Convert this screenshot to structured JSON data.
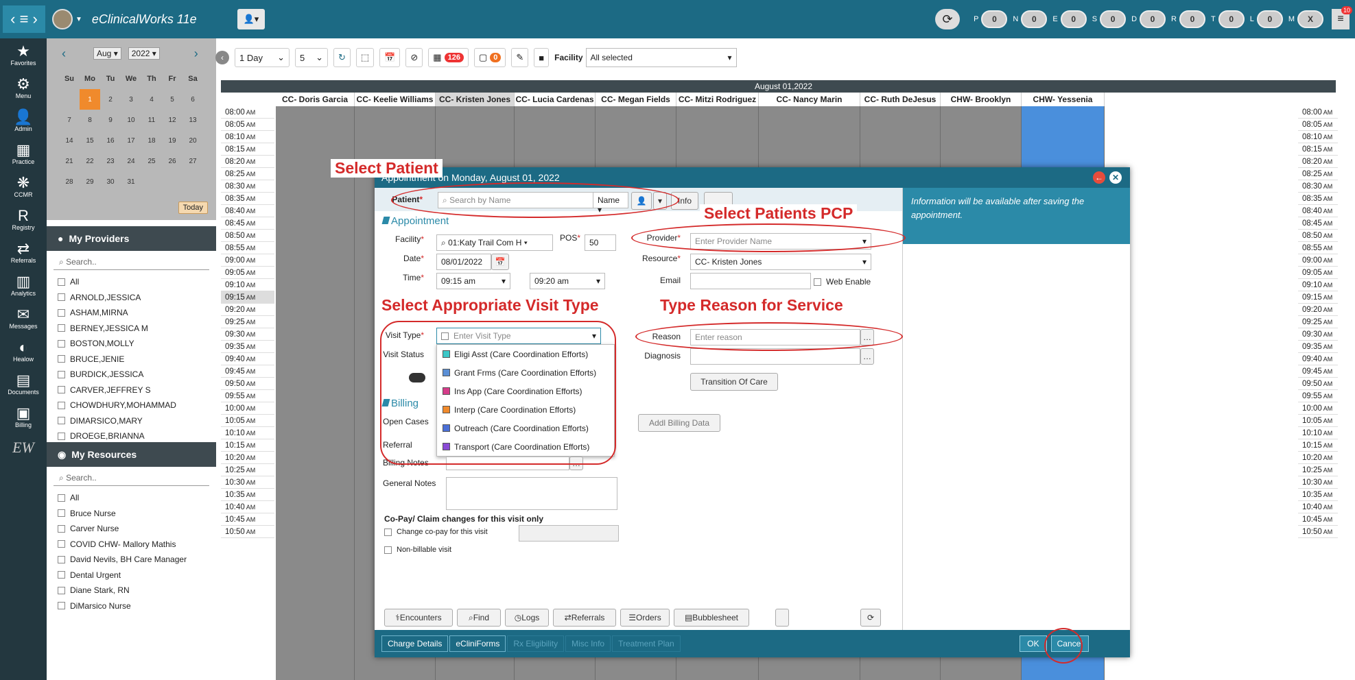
{
  "app": {
    "title": "eClinicalWorks 11e"
  },
  "topbar": {
    "counters": [
      {
        "key": "P",
        "value": "0"
      },
      {
        "key": "N",
        "value": "0"
      },
      {
        "key": "E",
        "value": "0"
      },
      {
        "key": "S",
        "value": "0"
      },
      {
        "key": "D",
        "value": "0"
      },
      {
        "key": "R",
        "value": "0"
      },
      {
        "key": "T",
        "value": "0"
      },
      {
        "key": "L",
        "value": "0"
      },
      {
        "key": "M",
        "value": "X"
      }
    ],
    "notif_count": "10"
  },
  "leftnav": {
    "items": [
      {
        "label": "Favorites",
        "icon": "★"
      },
      {
        "label": "Menu",
        "icon": "⚙"
      },
      {
        "label": "Admin",
        "icon": "👤"
      },
      {
        "label": "Practice",
        "icon": "▦"
      },
      {
        "label": "CCMR",
        "icon": "❋"
      },
      {
        "label": "Registry",
        "icon": "R"
      },
      {
        "label": "Referrals",
        "icon": "⇄"
      },
      {
        "label": "Analytics",
        "icon": "▥"
      },
      {
        "label": "Messages",
        "icon": "✉"
      },
      {
        "label": "Healow",
        "icon": "◐"
      },
      {
        "label": "Documents",
        "icon": "▤"
      },
      {
        "label": "Billing",
        "icon": "▣"
      }
    ],
    "logo": "EW"
  },
  "calendar": {
    "month": "Aug",
    "year": "2022",
    "days": [
      "Su",
      "Mo",
      "Tu",
      "We",
      "Th",
      "Fr",
      "Sa"
    ],
    "weeks": [
      [
        "",
        "1",
        "2",
        "3",
        "4",
        "5",
        "6"
      ],
      [
        "7",
        "8",
        "9",
        "10",
        "11",
        "12",
        "13"
      ],
      [
        "14",
        "15",
        "16",
        "17",
        "18",
        "19",
        "20"
      ],
      [
        "21",
        "22",
        "23",
        "24",
        "25",
        "26",
        "27"
      ],
      [
        "28",
        "29",
        "30",
        "31",
        "",
        "",
        ""
      ]
    ],
    "today_label": "Today"
  },
  "providers": {
    "title": "My Providers",
    "search_placeholder": "Search..",
    "items": [
      "All",
      "ARNOLD,JESSICA",
      "ASHAM,MIRNA",
      "BERNEY,JESSICA M",
      "BOSTON,MOLLY",
      "BRUCE,JENIE",
      "BURDICK,JESSICA",
      "CARVER,JEFFREY S",
      "CHOWDHURY,MOHAMMAD",
      "DIMARSICO,MARY",
      "DROEGE,BRIANNA"
    ]
  },
  "resources": {
    "title": "My Resources",
    "search_placeholder": "Search..",
    "items": [
      "All",
      "Bruce Nurse",
      "Carver Nurse",
      "COVID CHW- Mallory Mathis",
      "David Nevils, BH Care Manager",
      "Dental Urgent",
      "Diane Stark, RN",
      "DiMarsico Nurse"
    ]
  },
  "toolbar": {
    "view": "1 Day",
    "interval": "5",
    "badge1": "126",
    "badge2": "0",
    "facility_label": "Facility",
    "facility_value": "All selected"
  },
  "schedule": {
    "date": "August 01,2022",
    "columns": [
      "CC- Doris Garcia",
      "CC- Keelie Williams",
      "CC- Kristen Jones",
      "CC- Lucia Cardenas",
      "CC- Megan Fields",
      "CC- Mitzi Rodriguez",
      "CC- Nancy Marin",
      "CC- Ruth DeJesus",
      "CHW- Brooklyn James",
      "CHW- Yessenia Lopez"
    ],
    "times": [
      "08:00",
      "08:05",
      "08:10",
      "08:15",
      "08:20",
      "08:25",
      "08:30",
      "08:35",
      "08:40",
      "08:45",
      "08:50",
      "08:55",
      "09:00",
      "09:05",
      "09:10",
      "09:15",
      "09:20",
      "09:25",
      "09:30",
      "09:35",
      "09:40",
      "09:45",
      "09:50",
      "09:55",
      "10:00",
      "10:05",
      "10:10",
      "10:15",
      "10:20",
      "10:25",
      "10:30",
      "10:35",
      "10:40",
      "10:45",
      "10:50"
    ],
    "ampm": "AM"
  },
  "modal": {
    "title": "Appointment on Monday, August 01, 2022",
    "patient_label": "Patient",
    "patient_placeholder": "Search by Name",
    "name_dd": "Name",
    "info_btn": "Info",
    "section_appointment": "Appointment",
    "facility_label": "Facility",
    "facility_value": "01:Katy Trail Com H",
    "pos_label": "POS",
    "pos_value": "50",
    "date_label": "Date",
    "date_value": "08/01/2022",
    "time_label": "Time",
    "time_start": "09:15 am",
    "time_end": "09:20 am",
    "provider_label": "Provider",
    "provider_placeholder": "Enter Provider Name",
    "resource_label": "Resource",
    "resource_value": "CC- Kristen Jones",
    "email_label": "Email",
    "web_enable": "Web Enable",
    "visit_type_label": "Visit Type",
    "visit_type_placeholder": "Enter Visit Type",
    "visit_status_label": "Visit Status",
    "visit_types": [
      {
        "label": "Eligi Asst (Care Coordination Efforts)",
        "color": "#3cc7c7"
      },
      {
        "label": "Grant Frms (Care Coordination Efforts)",
        "color": "#5b8fd6"
      },
      {
        "label": "Ins App (Care Coordination Efforts)",
        "color": "#d63c8a"
      },
      {
        "label": "Interp (Care Coordination Efforts)",
        "color": "#f08a2c"
      },
      {
        "label": "Outreach (Care Coordination Efforts)",
        "color": "#4b6fd6"
      },
      {
        "label": "Transport (Care Coordination Efforts)",
        "color": "#8a4bd6"
      }
    ],
    "reason_label": "Reason",
    "reason_placeholder": "Enter reason",
    "diagnosis_label": "Diagnosis",
    "transition_btn": "Transition Of Care",
    "section_billing": "Billing",
    "open_cases": "Open Cases",
    "referral": "Referral",
    "billing_notes": "Billing Notes",
    "general_notes": "General Notes",
    "addl_billing": "Addl Billing Data",
    "copay_heading": "Co-Pay/ Claim changes for this visit only",
    "change_copay": "Change co-pay for this visit",
    "non_billable": "Non-billable visit",
    "info_text": "Information will be available after saving the appointment.",
    "bottom_btns": [
      "Encounters",
      "Find",
      "Logs",
      "Referrals",
      "Orders",
      "Bubblesheet"
    ],
    "tabs": [
      "Charge Details",
      "eCliniForms",
      "Rx Eligibility",
      "Misc Info",
      "Treatment Plan"
    ],
    "ok": "OK",
    "cancel": "Cancel"
  },
  "annotations": {
    "select_patient": "Select Patient",
    "select_pcp": "Select Patients PCP",
    "select_visit_type": "Select Appropriate Visit Type",
    "type_reason": "Type Reason for Service"
  }
}
